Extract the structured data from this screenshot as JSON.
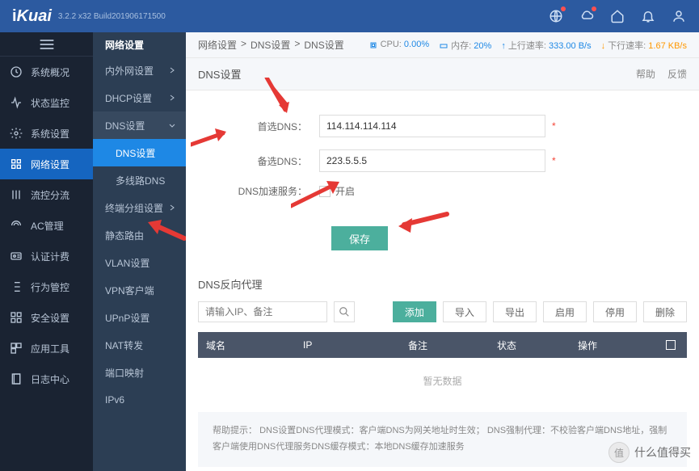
{
  "header": {
    "brand": "iKuai",
    "version": "3.2.2 x32 Build201906171500"
  },
  "sidebar1": {
    "items": [
      {
        "label": "系统概况"
      },
      {
        "label": "状态监控"
      },
      {
        "label": "系统设置"
      },
      {
        "label": "网络设置"
      },
      {
        "label": "流控分流"
      },
      {
        "label": "AC管理"
      },
      {
        "label": "认证计费"
      },
      {
        "label": "行为管控"
      },
      {
        "label": "安全设置"
      },
      {
        "label": "应用工具"
      },
      {
        "label": "日志中心"
      }
    ]
  },
  "sidebar2": {
    "title": "网络设置",
    "items": [
      {
        "label": "内外网设置"
      },
      {
        "label": "DHCP设置"
      },
      {
        "label": "DNS设置"
      },
      {
        "label": "DNS设置",
        "sub": true
      },
      {
        "label": "多线路DNS",
        "sub": true
      },
      {
        "label": "终端分组设置"
      },
      {
        "label": "静态路由"
      },
      {
        "label": "VLAN设置"
      },
      {
        "label": "VPN客户端"
      },
      {
        "label": "UPnP设置"
      },
      {
        "label": "NAT转发"
      },
      {
        "label": "端口映射"
      },
      {
        "label": "IPv6"
      }
    ]
  },
  "breadcrumb": {
    "p1": "网络设置",
    "p2": "DNS设置",
    "p3": "DNS设置",
    "cpu_label": "CPU:",
    "cpu_val": "0.00%",
    "mem_label": "内存:",
    "mem_val": "20%",
    "up_label": "上行速率:",
    "up_val": "333.00 B/s",
    "down_label": "下行速率:",
    "down_val": "1.67 KB/s"
  },
  "section": {
    "title": "DNS设置",
    "help": "帮助",
    "feedback": "反馈"
  },
  "form": {
    "primary_label": "首选DNS：",
    "primary_val": "114.114.114.114",
    "secondary_label": "备选DNS：",
    "secondary_val": "223.5.5.5",
    "accel_label": "DNS加速服务：",
    "accel_enable": "开启",
    "save": "保存"
  },
  "reverse_proxy": {
    "title": "DNS反向代理",
    "search_placeholder": "请输入IP、备注",
    "add": "添加",
    "import": "导入",
    "export": "导出",
    "enable": "启用",
    "disable": "停用",
    "delete": "删除",
    "cols": {
      "domain": "域名",
      "ip": "IP",
      "remark": "备注",
      "status": "状态",
      "action": "操作"
    },
    "nodata": "暂无数据"
  },
  "help_text": {
    "prefix": "帮助提示：",
    "line1": "DNS设置DNS代理模式：客户端DNS为网关地址时生效；",
    "line1b": "DNS强制代理：不校验客户端DNS地址，强制客户端使用DNS代理服务DNS缓存模式：本地DNS缓存加速服务"
  },
  "watermark": {
    "char": "值",
    "text": "什么值得买"
  }
}
